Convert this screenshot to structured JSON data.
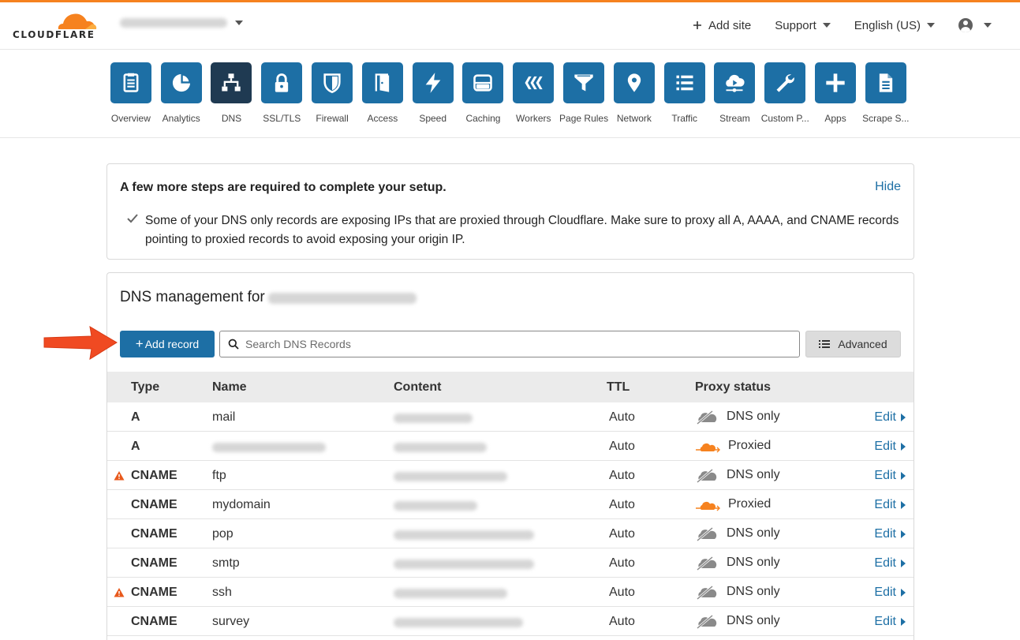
{
  "header": {
    "brand": "CLOUDFLARE",
    "add_site": "Add site",
    "support": "Support",
    "language": "English (US)"
  },
  "apps": [
    {
      "label": "Overview",
      "icon": "clipboard-icon",
      "active": false
    },
    {
      "label": "Analytics",
      "icon": "pie-chart-icon",
      "active": false
    },
    {
      "label": "DNS",
      "icon": "network-tree-icon",
      "active": true
    },
    {
      "label": "SSL/TLS",
      "icon": "lock-icon",
      "active": false
    },
    {
      "label": "Firewall",
      "icon": "shield-icon",
      "active": false
    },
    {
      "label": "Access",
      "icon": "door-icon",
      "active": false
    },
    {
      "label": "Speed",
      "icon": "lightning-icon",
      "active": false
    },
    {
      "label": "Caching",
      "icon": "server-icon",
      "active": false
    },
    {
      "label": "Workers",
      "icon": "workers-icon",
      "active": false
    },
    {
      "label": "Page Rules",
      "icon": "filter-icon",
      "active": false
    },
    {
      "label": "Network",
      "icon": "location-pin-icon",
      "active": false
    },
    {
      "label": "Traffic",
      "icon": "list-icon",
      "active": false
    },
    {
      "label": "Stream",
      "icon": "cloud-play-icon",
      "active": false
    },
    {
      "label": "Custom P...",
      "icon": "wrench-icon",
      "active": false
    },
    {
      "label": "Apps",
      "icon": "plus-icon",
      "active": false
    },
    {
      "label": "Scrape S...",
      "icon": "document-icon",
      "active": false
    }
  ],
  "setup": {
    "title": "A few more steps are required to complete your setup.",
    "hide": "Hide",
    "message": "Some of your DNS only records are exposing IPs that are proxied through Cloudflare. Make sure to proxy all A, AAAA, and CNAME records pointing to proxied records to avoid exposing your origin IP."
  },
  "dns": {
    "title": "DNS management for",
    "add_record": "Add record",
    "search_placeholder": "Search DNS Records",
    "advanced": "Advanced",
    "columns": {
      "type": "Type",
      "name": "Name",
      "content": "Content",
      "ttl": "TTL",
      "proxy": "Proxy status"
    },
    "edit_label": "Edit",
    "records": [
      {
        "type": "A",
        "name": "mail",
        "ttl": "Auto",
        "proxy": "DNS only",
        "proxied": false,
        "warning": false
      },
      {
        "type": "A",
        "name": "",
        "ttl": "Auto",
        "proxy": "Proxied",
        "proxied": true,
        "warning": false
      },
      {
        "type": "CNAME",
        "name": "ftp",
        "ttl": "Auto",
        "proxy": "DNS only",
        "proxied": false,
        "warning": true
      },
      {
        "type": "CNAME",
        "name": "mydomain",
        "ttl": "Auto",
        "proxy": "Proxied",
        "proxied": true,
        "warning": false
      },
      {
        "type": "CNAME",
        "name": "pop",
        "ttl": "Auto",
        "proxy": "DNS only",
        "proxied": false,
        "warning": false
      },
      {
        "type": "CNAME",
        "name": "smtp",
        "ttl": "Auto",
        "proxy": "DNS only",
        "proxied": false,
        "warning": false
      },
      {
        "type": "CNAME",
        "name": "ssh",
        "ttl": "Auto",
        "proxy": "DNS only",
        "proxied": false,
        "warning": true
      },
      {
        "type": "CNAME",
        "name": "survey",
        "ttl": "Auto",
        "proxy": "DNS only",
        "proxied": false,
        "warning": false
      }
    ]
  },
  "colors": {
    "brand_orange": "#f6821f",
    "primary_blue": "#1d6fa5",
    "active_tile": "#1f3a52",
    "warning": "#e8591c",
    "annotation_arrow": "#f04a22"
  }
}
